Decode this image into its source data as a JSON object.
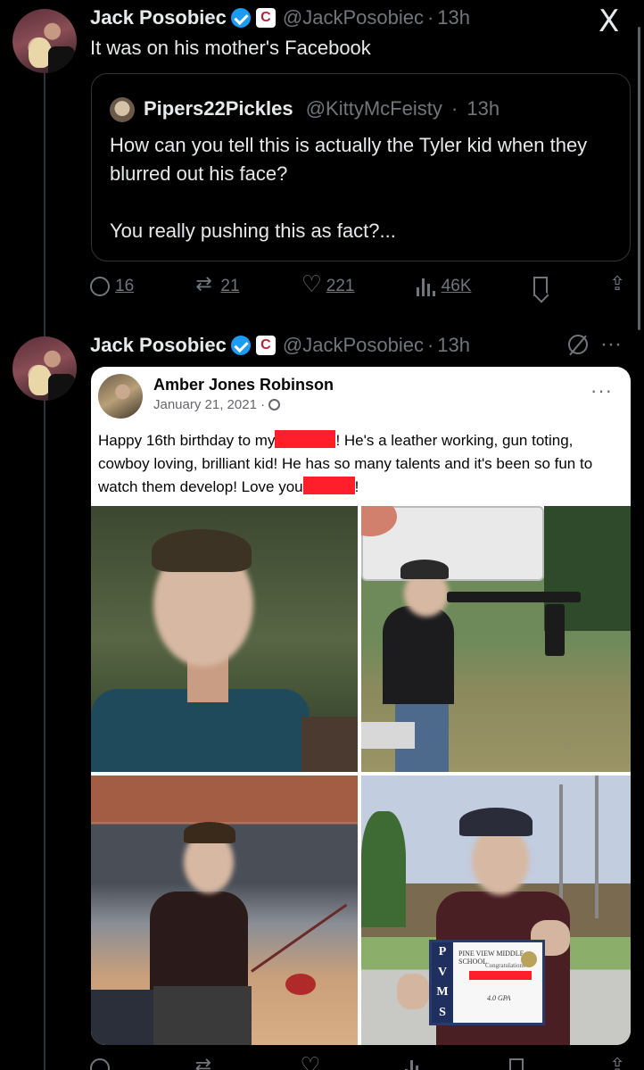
{
  "tweet1": {
    "name": "Jack Posobiec",
    "affiliation_glyph": "C",
    "handle": "@JackPosobiec",
    "time": "13h",
    "text": "It was on his mother's Facebook"
  },
  "x_logo": "X",
  "quote": {
    "name": "Pipers22Pickles",
    "handle": "@KittyMcFeisty",
    "time": "13h",
    "text_line1": "How can you tell this is actually the Tyler kid when they blurred out his face?",
    "text_line2": "You really pushing this as fact?..."
  },
  "actions1": {
    "replies": "16",
    "reposts": "21",
    "likes": "221",
    "views": "46K"
  },
  "tweet2": {
    "name": "Jack Posobiec",
    "affiliation_glyph": "C",
    "handle": "@JackPosobiec",
    "time": "13h",
    "more": "···"
  },
  "facebook_post": {
    "author": "Amber Jones Robinson",
    "date": "January 21, 2021 ·",
    "more": "···",
    "text_a": "Happy 16th birthday to my",
    "text_b": "! He's a leather working, gun toting, cowboy loving, brilliant kid! He has so many talents and it's been so fun to watch them develop! Love you",
    "text_c": "!"
  },
  "certificate": {
    "side_letters": [
      "P",
      "V",
      "M",
      "S"
    ],
    "school": "PINE VIEW MIDDLE SCHOOL",
    "line": "Congratulations",
    "gpa": "4.0 GPA"
  },
  "colors": {
    "verified_blue": "#1d9bf0",
    "redaction": "#ff1f2a",
    "muted_gray": "#71767b"
  }
}
